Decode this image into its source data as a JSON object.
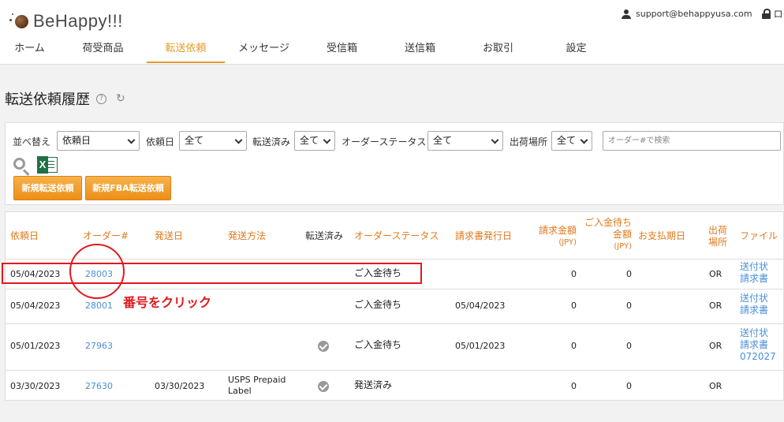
{
  "header": {
    "logo_text": "BeHappy!!!",
    "user_email": "support@behappyusa.com",
    "logout_label": "ログアウト"
  },
  "nav": {
    "items": [
      {
        "label": "ホーム",
        "active": false
      },
      {
        "label": "荷受商品",
        "active": false
      },
      {
        "label": "転送依頼",
        "active": true
      },
      {
        "label": "メッセージ",
        "active": false
      },
      {
        "label": "受信箱",
        "active": false
      },
      {
        "label": "送信箱",
        "active": false
      },
      {
        "label": "お取引",
        "active": false
      },
      {
        "label": "設定",
        "active": false
      }
    ]
  },
  "page": {
    "title": "転送依頼履歴",
    "help_icon": "?",
    "refresh_icon": "↻"
  },
  "filters": {
    "sort_label": "並べ替え",
    "sort_value": "依頼日",
    "request_date_label": "依頼日",
    "request_date_value": "全て",
    "forwarded_label": "転送済み",
    "forwarded_value": "全て",
    "order_status_label": "オーダーステータス",
    "order_status_value": "全て",
    "shipping_place_label": "出荷場所",
    "shipping_place_value": "全て",
    "search_placeholder": "オーダー#で検索",
    "new_request_button": "新規転送依頼",
    "new_fba_request_button": "新規FBA転送依頼",
    "excel_icon_letter": "X"
  },
  "table": {
    "headers": {
      "request_date": "依頼日",
      "order_no": "オーダー#",
      "ship_date": "発送日",
      "ship_method": "発送方法",
      "forwarded": "転送済み",
      "order_status": "オーダーステータス",
      "invoice_date": "請求書発行日",
      "invoice_amount_line1": "請求金額",
      "invoice_amount_line2": "(JPY)",
      "pending_amount_line1": "ご入金待ち",
      "pending_amount_line2": "金額",
      "pending_amount_line3": "(JPY)",
      "payment_due": "お支払期日",
      "ship_place_line1": "出荷",
      "ship_place_line2": "場所",
      "file": "ファイル"
    },
    "rows": [
      {
        "request_date": "05/04/2023",
        "order_no": "28003",
        "ship_date": "",
        "ship_method_line1": "",
        "ship_method_line2": "",
        "forwarded": false,
        "order_status": "ご入金待ち",
        "invoice_date": "",
        "invoice_amount": "0",
        "pending_amount": "0",
        "payment_due": "",
        "ship_place": "OR",
        "files": [
          "送付状",
          "請求書"
        ]
      },
      {
        "request_date": "05/04/2023",
        "order_no": "28001",
        "ship_date": "",
        "ship_method_line1": "",
        "ship_method_line2": "",
        "forwarded": false,
        "order_status": "ご入金待ち",
        "invoice_date": "05/04/2023",
        "invoice_amount": "0",
        "pending_amount": "0",
        "payment_due": "",
        "ship_place": "OR",
        "files": [
          "送付状",
          "請求書"
        ]
      },
      {
        "request_date": "05/01/2023",
        "order_no": "27963",
        "ship_date": "",
        "ship_method_line1": "",
        "ship_method_line2": "",
        "forwarded": true,
        "order_status": "ご入金待ち",
        "invoice_date": "05/01/2023",
        "invoice_amount": "0",
        "pending_amount": "0",
        "payment_due": "",
        "ship_place": "OR",
        "files": [
          "送付状",
          "請求書",
          "072027"
        ]
      },
      {
        "request_date": "03/30/2023",
        "order_no": "27630",
        "ship_date": "03/30/2023",
        "ship_method_line1": "USPS Prepaid",
        "ship_method_line2": "Label",
        "forwarded": true,
        "order_status": "発送済み",
        "invoice_date": "",
        "invoice_amount": "0",
        "pending_amount": "0",
        "payment_due": "",
        "ship_place": "OR",
        "files": []
      }
    ]
  },
  "annotation": {
    "text": "番号をクリック"
  }
}
